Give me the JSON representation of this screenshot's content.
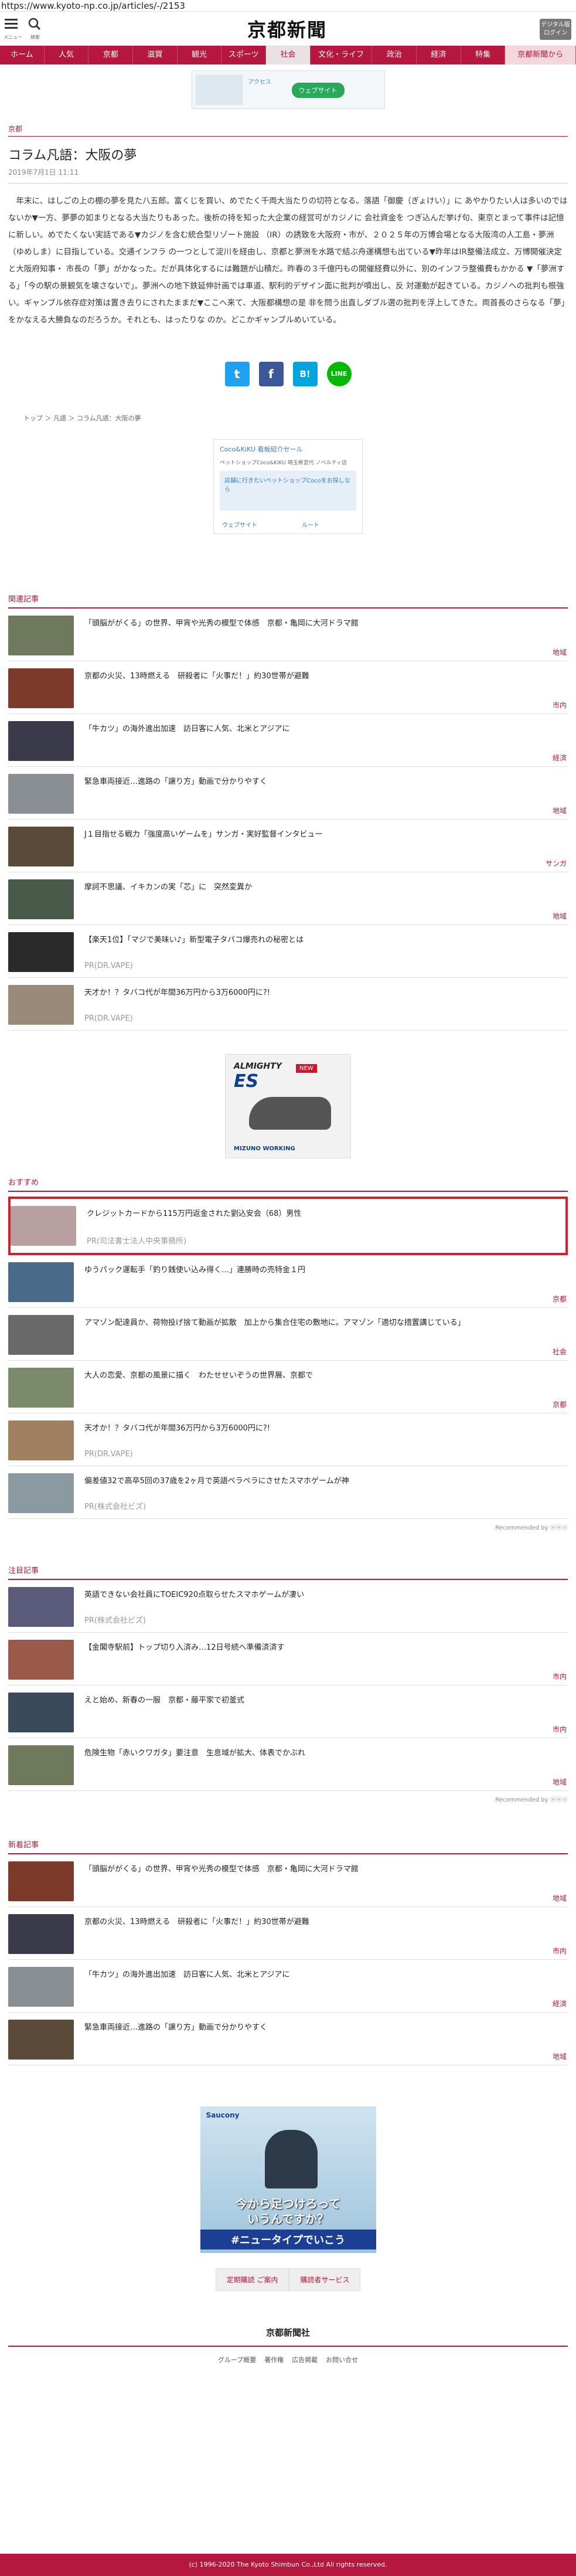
{
  "url": "https://www.kyoto-np.co.jp/articles/-/2153",
  "header": {
    "menu_label": "メニュー",
    "search_label": "検索",
    "logo": "京都新聞",
    "digital": "デジタル版ログイン"
  },
  "nav": [
    "ホーム",
    "人気",
    "京都",
    "滋賀",
    "観光",
    "スポーツ",
    "社会",
    "文化・ライフ",
    "政治",
    "経済",
    "特集",
    "京都新聞から"
  ],
  "ad_top": {
    "title": "アクセス",
    "button": "ウェブサイト"
  },
  "category": "京都",
  "article": {
    "title": "コラム凡語：大阪の夢",
    "date": "2019年7月1日 11:11",
    "body": "年末に、はしごの上の棚の夢を見た八五郎。富くじを買い、めでたく千両大当たりの切り…",
    "body_full": "年末に、はしごの上の棚の夢を見た八五郎。富くじを買い、めでたく千両大当たりの切符となる。落語「御慶（ぎょけい）」に あやかりたい人は多いのではないか▼一方、夢夢の如まりとなる大当たりもあった。後析の持を知った大企業の経営可がカジノに 会社資金を つぎ込んだ挙げ句、東京とまって事件は記憶に新しい。めでたくない実話である▼カジノを含む統合型リゾート施設 （IR）の誘致を大阪府・市が、２０２５年の万博会場となる大阪湾の人工島・夢洲（ゆめしま）に目指している。交通インフラ の一つとして淀川を経由し、京都と夢洲を水路で結ぶ舟運構想も出ている▼昨年はIR整備法成立、万博開催決定と大阪府知事・ 市長の「夢」がかなった。だが具体化するには難題が山積だ。昨春の３千億円もの開催経費以外に、別のインフラ整備費もかかる ▼「夢洲する」「今の駅の景観気を壊さないで」。夢洲への地下鉄延伸計画では車道、駅利的デザイン面に批判が噴出し、反 対運動が起きている。カジノへの批判も根強い。ギャンブル依存症対策は置き去りにされたままだ▼ここへ来て、大阪都構想の是 非を問う出直しダブル選の批判を浮上してきた。両首長のさらなる「夢」をかなえる大勝負なのだろうか。それとも、はったりな のか。どこかギャンブルめいている。"
  },
  "share": {
    "twitter": "t",
    "facebook": "f",
    "hatena": "B!",
    "line": "LINE"
  },
  "breadcrumb": "トップ ＞ 凡語 ＞ コラム凡語：大阪の夢",
  "ad_mid": {
    "title": "Coco&KiKU 看板紹介セール",
    "sub": "ペットショップCoco&KiKU 埼玉県宮代 ノベルティ店",
    "cta": "店舗に行きたいペットショップCocoをお探しなら",
    "web": "ウェブサイト",
    "route": "ルート"
  },
  "related_title": "関連記事",
  "related": [
    {
      "title": "「頭脳ががくる」の世界、甲宵や光秀の模型で体感　京都・亀岡に大河ドラマ館",
      "tag": "地域"
    },
    {
      "title": "京都の火災、13時燃える　研殺者に「火事だ！」約30世帯が避難",
      "tag": "市内"
    },
    {
      "title": "「牛カツ」の海外進出加速　訪日客に人気、北米とアジアに",
      "tag": "経済"
    },
    {
      "title": "緊急車両接近…進路の「譲り方」動画で分かりやすく",
      "tag": "地域"
    },
    {
      "title": "J１目指せる戦力「強度高いゲームを」サンガ・実好監督インタビュー",
      "tag": "サンガ"
    },
    {
      "title": "摩訶不思議、イキカンの実「芯」に　突然変異か",
      "tag": "地域"
    },
    {
      "title": "【楽天1位】「マジで美味い♪」新型電子タバコ爆売れの秘密とは",
      "pr": "PR(DR.VAPE)"
    },
    {
      "title": "天才か！？タバコ代が年間36万円から3万6000円に?!",
      "pr": "PR(DR.VAPE)"
    }
  ],
  "ad_shoe": {
    "brand": "ALMIGHTY",
    "model": "ES",
    "badge": "NEW",
    "maker": "MIZUNO WORKING"
  },
  "recommend_title": "おすすめ",
  "recommend": [
    {
      "title": "クレジットカードから115万円返金された劉込安会（68）男性",
      "pr": "PR(司法書士法人中央事務所)"
    },
    {
      "title": "ゆうパック運転手「釣り銭使い込み得く…」連勝時の売特金１円",
      "tag": "京都"
    },
    {
      "title": "アマゾン配達員か、荷物投げ捨て動画が拡散　加上から集合住宅の敷地に。アマゾン「適切な措置講じている」",
      "tag": "社会"
    },
    {
      "title": "大人の恋愛、京都の風景に描く　わたせせいぞうの世界展、京都で",
      "tag": "京都"
    },
    {
      "title": "天才か！？タバコ代が年間36万円から3万6000円に?!",
      "pr": "PR(DR.VAPE)"
    },
    {
      "title": "偏差値32で高卒5回の37歳を2ヶ月で英語ペラペラにさせたスマホゲームが神",
      "pr": "PR(株式会社ビズ)"
    }
  ],
  "rec_by": "Recommended by ⓤⓞⓤ",
  "attention_title": "注目記事",
  "attention": [
    {
      "title": "英語できない会社員にTOEIC920点取らせたスマホゲームが凄い",
      "pr": "PR(株式会社ビズ)"
    },
    {
      "title": "【金閣寺駅前】トップ切り入済み…12日号続へ準備済済す",
      "tag": "市内"
    },
    {
      "title": "えと始め、新春の一服　京都・藤平家で初釜式",
      "tag": "市内"
    },
    {
      "title": "危険生物「赤いクワガタ」要注意　生息域が拡大、体表でかぶれ",
      "tag": "地域"
    }
  ],
  "rec_by2": "Recommended by ⓤⓞⓤ",
  "latest_title": "新着記事",
  "latest": [
    {
      "title": "「頭脳ががくる」の世界、甲宵や光秀の模型で体感　京都・亀岡に大河ドラマ館",
      "tag": "地域"
    },
    {
      "title": "京都の火災、13時燃える　研殺者に「火事だ！」約30世帯が避難",
      "tag": "市内"
    },
    {
      "title": "「牛カツ」の海外進出加速　訪日客に人気、北米とアジアに",
      "tag": "経済"
    },
    {
      "title": "緊急車両接近…進路の「譲り方」動画で分かりやすく",
      "tag": "地域"
    }
  ],
  "ad_bottom": {
    "brand": "Saucony",
    "line1": "今から足つけろって",
    "line2": "いうんですか？",
    "line3": "#ニュータイプでいこう"
  },
  "buttons": [
    "定期購読 ご案内",
    "購読者サービス"
  ],
  "footer": {
    "logo": "京都新聞社",
    "links": [
      "グループ概要",
      "著作権",
      "広告掲載",
      "お問い合せ"
    ],
    "copyright": "(c) 1996-2020 The Kyoto Shimbun Co.,Ltd All rights reserved."
  }
}
